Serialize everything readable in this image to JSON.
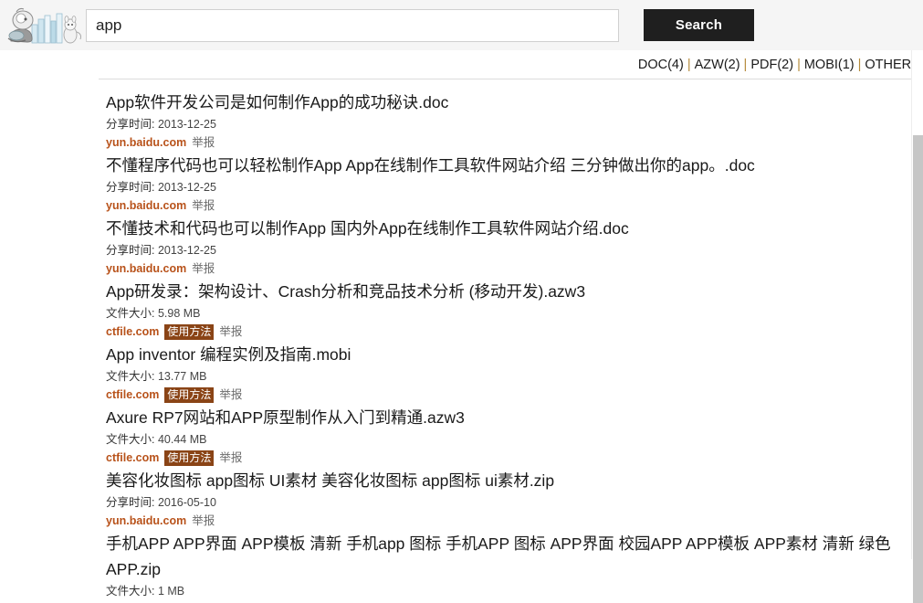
{
  "header": {
    "logo_name": "site-logo",
    "search": {
      "value": "app",
      "placeholder": "",
      "button_label": "Search"
    }
  },
  "filters": {
    "items": [
      {
        "label": "DOC(4)"
      },
      {
        "label": "AZW(2)"
      },
      {
        "label": "PDF(2)"
      },
      {
        "label": "MOBI(1)"
      },
      {
        "label": "OTHER("
      }
    ],
    "separator": "|"
  },
  "labels": {
    "share_time": "分享时间:",
    "file_size": "文件大小:",
    "report": "举报",
    "howto": "使用方法"
  },
  "results": [
    {
      "title": "App软件开发公司是如何制作App的成功秘诀.doc",
      "meta_label": "分享时间:",
      "meta_value": "2013-12-25",
      "source": "yun.baidu.com",
      "has_howto": false,
      "report": "举报"
    },
    {
      "title": "不懂程序代码也可以轻松制作App App在线制作工具软件网站介绍 三分钟做出你的app。.doc",
      "meta_label": "分享时间:",
      "meta_value": "2013-12-25",
      "source": "yun.baidu.com",
      "has_howto": false,
      "report": "举报"
    },
    {
      "title": "不懂技术和代码也可以制作App 国内外App在线制作工具软件网站介绍.doc",
      "meta_label": "分享时间:",
      "meta_value": "2013-12-25",
      "source": "yun.baidu.com",
      "has_howto": false,
      "report": "举报"
    },
    {
      "title": "App研发录：架构设计、Crash分析和竞品技术分析 (移动开发).azw3",
      "meta_label": "文件大小:",
      "meta_value": "5.98 MB",
      "source": "ctfile.com",
      "has_howto": true,
      "howto": "使用方法",
      "report": "举报"
    },
    {
      "title": "App inventor 编程实例及指南.mobi",
      "meta_label": "文件大小:",
      "meta_value": "13.77 MB",
      "source": "ctfile.com",
      "has_howto": true,
      "howto": "使用方法",
      "report": "举报"
    },
    {
      "title": "Axure RP7网站和APP原型制作从入门到精通.azw3",
      "meta_label": "文件大小:",
      "meta_value": "40.44 MB",
      "source": "ctfile.com",
      "has_howto": true,
      "howto": "使用方法",
      "report": "举报"
    },
    {
      "title": "美容化妆图标 app图标 UI素材 美容化妆图标 app图标 ui素材.zip",
      "meta_label": "分享时间:",
      "meta_value": "2016-05-10",
      "source": "yun.baidu.com",
      "has_howto": false,
      "report": "举报"
    },
    {
      "title": "手机APP APP界面 APP模板 清新 手机app 图标 手机APP 图标 APP界面 校园APP APP模板 APP素材 清新 绿色APP.zip",
      "meta_label": "文件大小:",
      "meta_value": "1 MB",
      "source": "",
      "has_howto": false,
      "report": ""
    }
  ],
  "colors": {
    "search_button_bg": "#1f1f1f",
    "source_link": "#b8521a",
    "howto_badge_bg": "#8a4416",
    "header_bg": "#f5f5f5",
    "divider": "#dcdcdc",
    "scrollbar_thumb": "#c6c6c6"
  }
}
